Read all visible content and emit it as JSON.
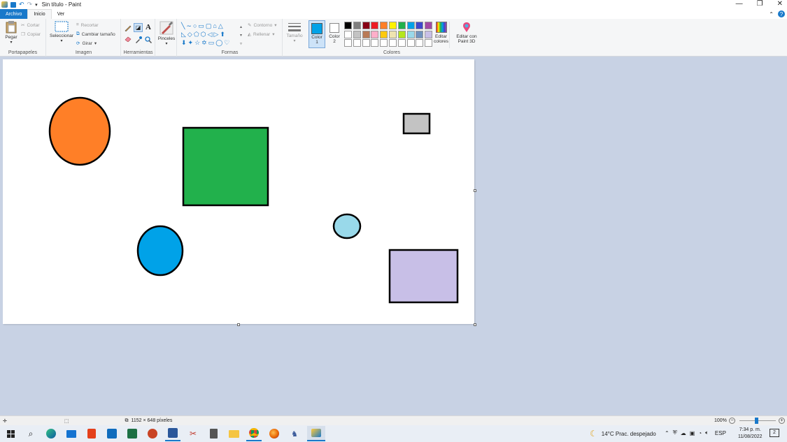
{
  "titlebar": {
    "title": "Sin título - Paint",
    "minimize": "—",
    "restore": "❐",
    "close": "✕"
  },
  "menu": {
    "file": "Archivo",
    "home": "Inicio",
    "view": "Ver",
    "help": "?"
  },
  "ribbon": {
    "clipboard": {
      "paste": "Pegar",
      "cut": "Cortar",
      "copy": "Copiar",
      "label": "Portapapeles"
    },
    "image": {
      "select": "Seleccionar",
      "crop": "Recortar",
      "resize": "Cambiar tamaño",
      "rotate": "Girar",
      "label": "Imagen"
    },
    "tools": {
      "label": "Herramientas",
      "text": "A"
    },
    "brushes": {
      "label": "Pinceles"
    },
    "shapes": {
      "label": "Formas",
      "outline": "Contorno",
      "fill": "Rellenar"
    },
    "size": {
      "label": "Tamaño"
    },
    "color1": {
      "label": "Color",
      "num": "1"
    },
    "color2": {
      "label": "Color",
      "num": "2"
    },
    "colors": {
      "label": "Colores"
    },
    "edit_colors": {
      "l1": "Editar",
      "l2": "colores"
    },
    "paint3d": {
      "l1": "Editar con",
      "l2": "Paint 3D"
    }
  },
  "palette": {
    "row1": [
      "#000000",
      "#7f7f7f",
      "#880015",
      "#ed1c24",
      "#ff7f27",
      "#fff200",
      "#22b14c",
      "#00a2e8",
      "#3f48cc",
      "#a349a4"
    ],
    "row2": [
      "#ffffff",
      "#c3c3c3",
      "#b97a57",
      "#ffaec9",
      "#ffc90e",
      "#efe4b0",
      "#b5e61d",
      "#99d9ea",
      "#7092be",
      "#c8bfe7"
    ],
    "row3": [
      "#ffffff",
      "#ffffff",
      "#ffffff",
      "#ffffff",
      "#ffffff",
      "#ffffff",
      "#ffffff",
      "#ffffff",
      "#ffffff",
      "#ffffff"
    ],
    "color1": "#00a2e8",
    "color2": "#ffffff"
  },
  "drawing": {
    "orange": "#ff7f27",
    "green": "#22b14c",
    "gray": "#c3c3c3",
    "lightblue": "#99d9ea",
    "blue": "#00a2e8",
    "lavender": "#c8bfe7"
  },
  "status": {
    "dimensions": "1152 × 648 píxeles",
    "zoom": "100%"
  },
  "taskbar": {
    "weather": "14°C  Prac. despejado",
    "lang": "ESP",
    "time": "7:34 p. m.",
    "date": "11/08/2022",
    "notifications": "2"
  }
}
